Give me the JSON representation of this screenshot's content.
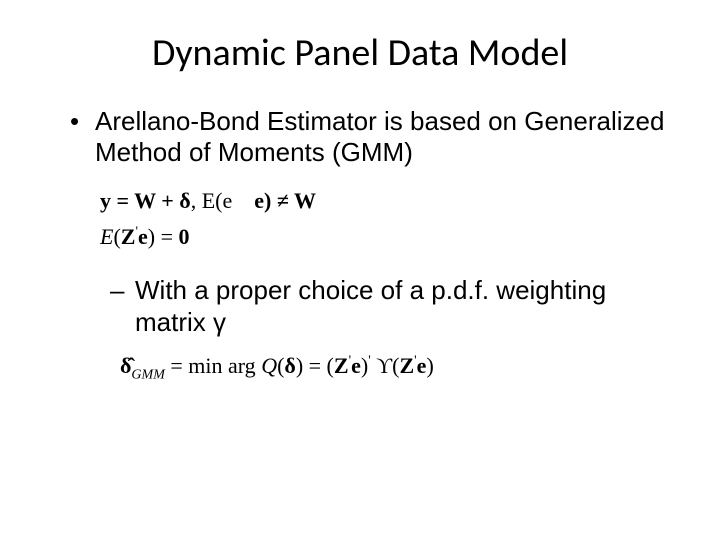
{
  "title": "Dynamic Panel Data Model",
  "bullets": {
    "main": "Arellano-Bond Estimator is based on Generalized Method of Moments (GMM)",
    "sub": "With a proper choice of a p.d.f. weighting matrix γ"
  },
  "equations": {
    "eq1_left": "y = W  + δ",
    "eq1_mid": ", E(e",
    "eq1_right": "e) ≠ W",
    "eq2": "E(Z",
    "eq2_prime": "'",
    "eq2_end": "e) = 0",
    "eq3_lhs_delta": "δ̂",
    "eq3_lhs_sub": "GMM",
    "eq3_mid": " = min arg Q(δ) = (Z",
    "eq3_prime": "'",
    "eq3_e": "e)",
    "eq3_upsilon": " ϒ",
    "eq3_paren2": "(Z",
    "eq3_prime2": "'",
    "eq3_e2": "e)"
  }
}
